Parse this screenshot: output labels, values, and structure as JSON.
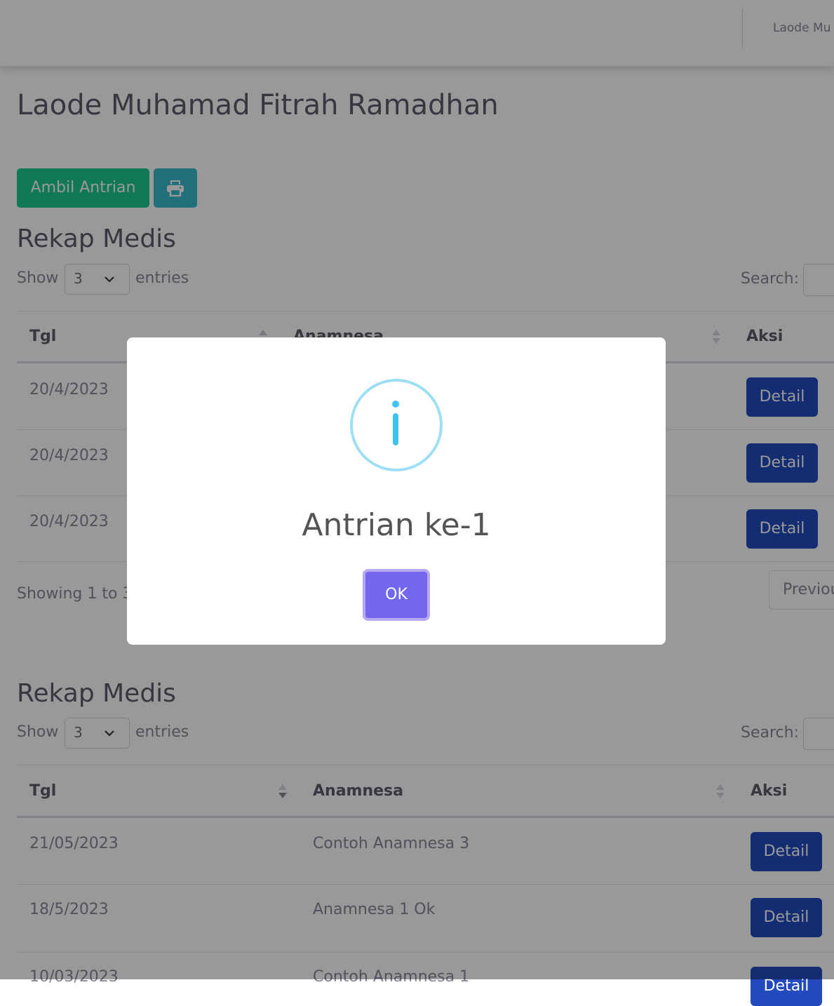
{
  "topbar": {
    "user_name": "Laode Mu"
  },
  "page_title": "Laode Muhamad Fitrah Ramadhan",
  "actions": {
    "ambil_antrian_label": "Ambil Antrian",
    "print_icon": "print-icon"
  },
  "table1": {
    "title": "Rekap Medis",
    "show_label": "Show",
    "entries_value": "3",
    "entries_label": "entries",
    "search_label": "Search:",
    "headers": [
      "Tgl",
      "Anamnesa",
      "Aksi"
    ],
    "rows": [
      {
        "tgl": "20/4/2023",
        "action": "Detail"
      },
      {
        "tgl": "20/4/2023",
        "action": "Detail"
      },
      {
        "tgl": "20/4/2023",
        "action": "Detail"
      }
    ],
    "info": "Showing 1 to 3",
    "prev_label": "Previou"
  },
  "table2": {
    "title": "Rekap Medis",
    "show_label": "Show",
    "entries_value": "3",
    "entries_label": "entries",
    "search_label": "Search:",
    "headers": [
      "Tgl",
      "Anamnesa",
      "Aksi"
    ],
    "rows": [
      {
        "tgl": "21/05/2023",
        "anamnesa": "Contoh Anamnesa 3",
        "action": "Detail"
      },
      {
        "tgl": "18/5/2023",
        "anamnesa": "Anamnesa 1 Ok",
        "action": "Detail"
      },
      {
        "tgl": "10/03/2023",
        "anamnesa": "Contoh Anamnesa 1",
        "action": "Detail"
      }
    ]
  },
  "modal": {
    "icon": "info-icon",
    "title": "Antrian ke-1",
    "ok_label": "OK"
  }
}
